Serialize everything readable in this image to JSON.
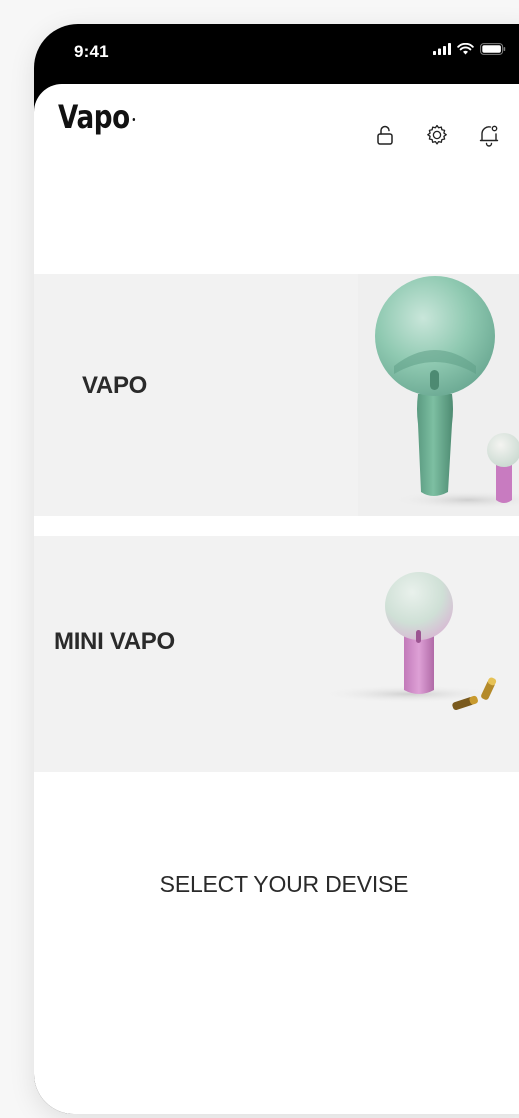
{
  "status_bar": {
    "time": "9:41",
    "icons": [
      "signal-icon",
      "wifi-icon",
      "battery-icon"
    ]
  },
  "header": {
    "logo": "Vapo",
    "icons": [
      "unlock-icon",
      "gear-icon",
      "bell-icon"
    ]
  },
  "devices": [
    {
      "label": "VAPO",
      "image": "vapo-device-image",
      "accent": "#6fb39a"
    },
    {
      "label": "MINI VAPO",
      "image": "mini-vapo-device-image",
      "accent": "#d79ed1"
    }
  ],
  "prompt": "SELECT YOUR DEVISE"
}
